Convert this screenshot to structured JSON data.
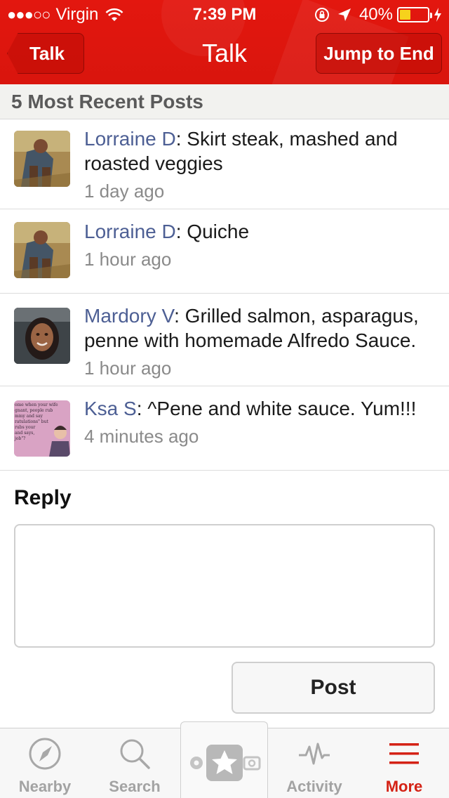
{
  "status_bar": {
    "signal": "●●●○○",
    "carrier": "Virgin",
    "time": "7:39 PM",
    "battery_percent": "40%",
    "battery_level": 0.4,
    "battery_color": "#f6d21c"
  },
  "nav": {
    "back_label": "Talk",
    "title": "Talk",
    "right_label": "Jump to End"
  },
  "section": {
    "title": "5 Most Recent Posts"
  },
  "posts": [
    {
      "author": "Lorraine D",
      "text": "Skirt steak, mashed and roasted veggies",
      "time": "1 day ago",
      "avatar": "lorraine-photo"
    },
    {
      "author": "Lorraine D",
      "text": "Quiche",
      "time": "1 hour ago",
      "avatar": "lorraine-photo"
    },
    {
      "author": "Mardory V",
      "text": "Grilled salmon, asparagus, penne with homemade Alfredo Sauce.",
      "time": "1 hour ago",
      "avatar": "mardory-photo"
    },
    {
      "author": "Ksa S",
      "text": "^Pene and white sauce. Yum!!!",
      "time": "4 minutes ago",
      "avatar": "ksa-meme-image"
    }
  ],
  "ksa_avatar_text": [
    "ome when your wife",
    "gnant, people rub",
    "mmy and say",
    "ratulations\" but",
    "rubs your",
    "and says,",
    "job\"?"
  ],
  "reply": {
    "label": "Reply",
    "placeholder": "",
    "value": "",
    "button_label": "Post"
  },
  "tabs": [
    {
      "label": "Nearby",
      "icon": "compass-icon",
      "active": false
    },
    {
      "label": "Search",
      "icon": "search-icon",
      "active": false
    },
    {
      "label": "",
      "icon": "check-in-star-icon",
      "active": false
    },
    {
      "label": "Activity",
      "icon": "activity-pulse-icon",
      "active": false
    },
    {
      "label": "More",
      "icon": "menu-icon",
      "active": true
    }
  ],
  "colors": {
    "brand_red": "#e3170f",
    "author_blue": "#4d5f94",
    "active_tab": "#d42215",
    "inactive_tab": "#a3a3a3"
  }
}
